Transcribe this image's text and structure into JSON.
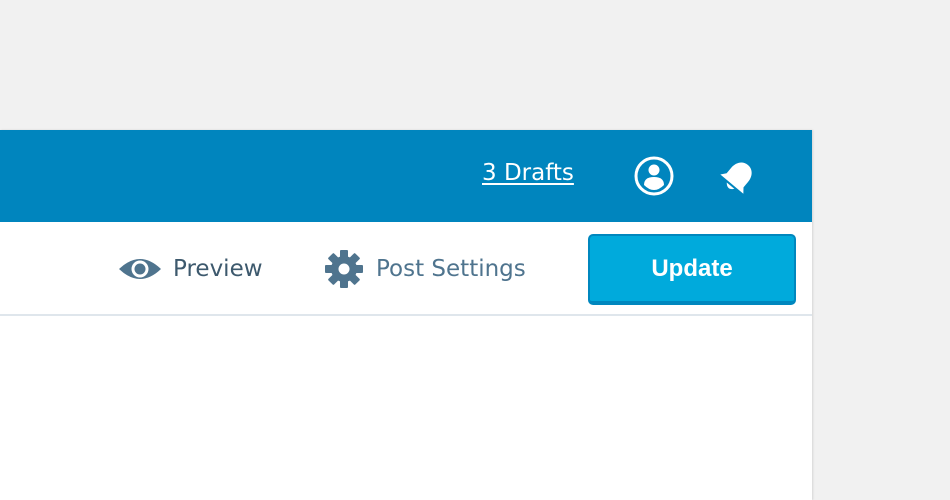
{
  "masterbar": {
    "drafts_label": "3 Drafts",
    "profile_icon": "user-circle-icon",
    "notifications_icon": "bell-icon",
    "background_color": "#0085be"
  },
  "toolbar": {
    "preview_label": "Preview",
    "preview_icon": "eye-icon",
    "settings_label": "Post Settings",
    "settings_icon": "gear-icon",
    "update_label": "Update",
    "update_color": "#00aadc"
  }
}
